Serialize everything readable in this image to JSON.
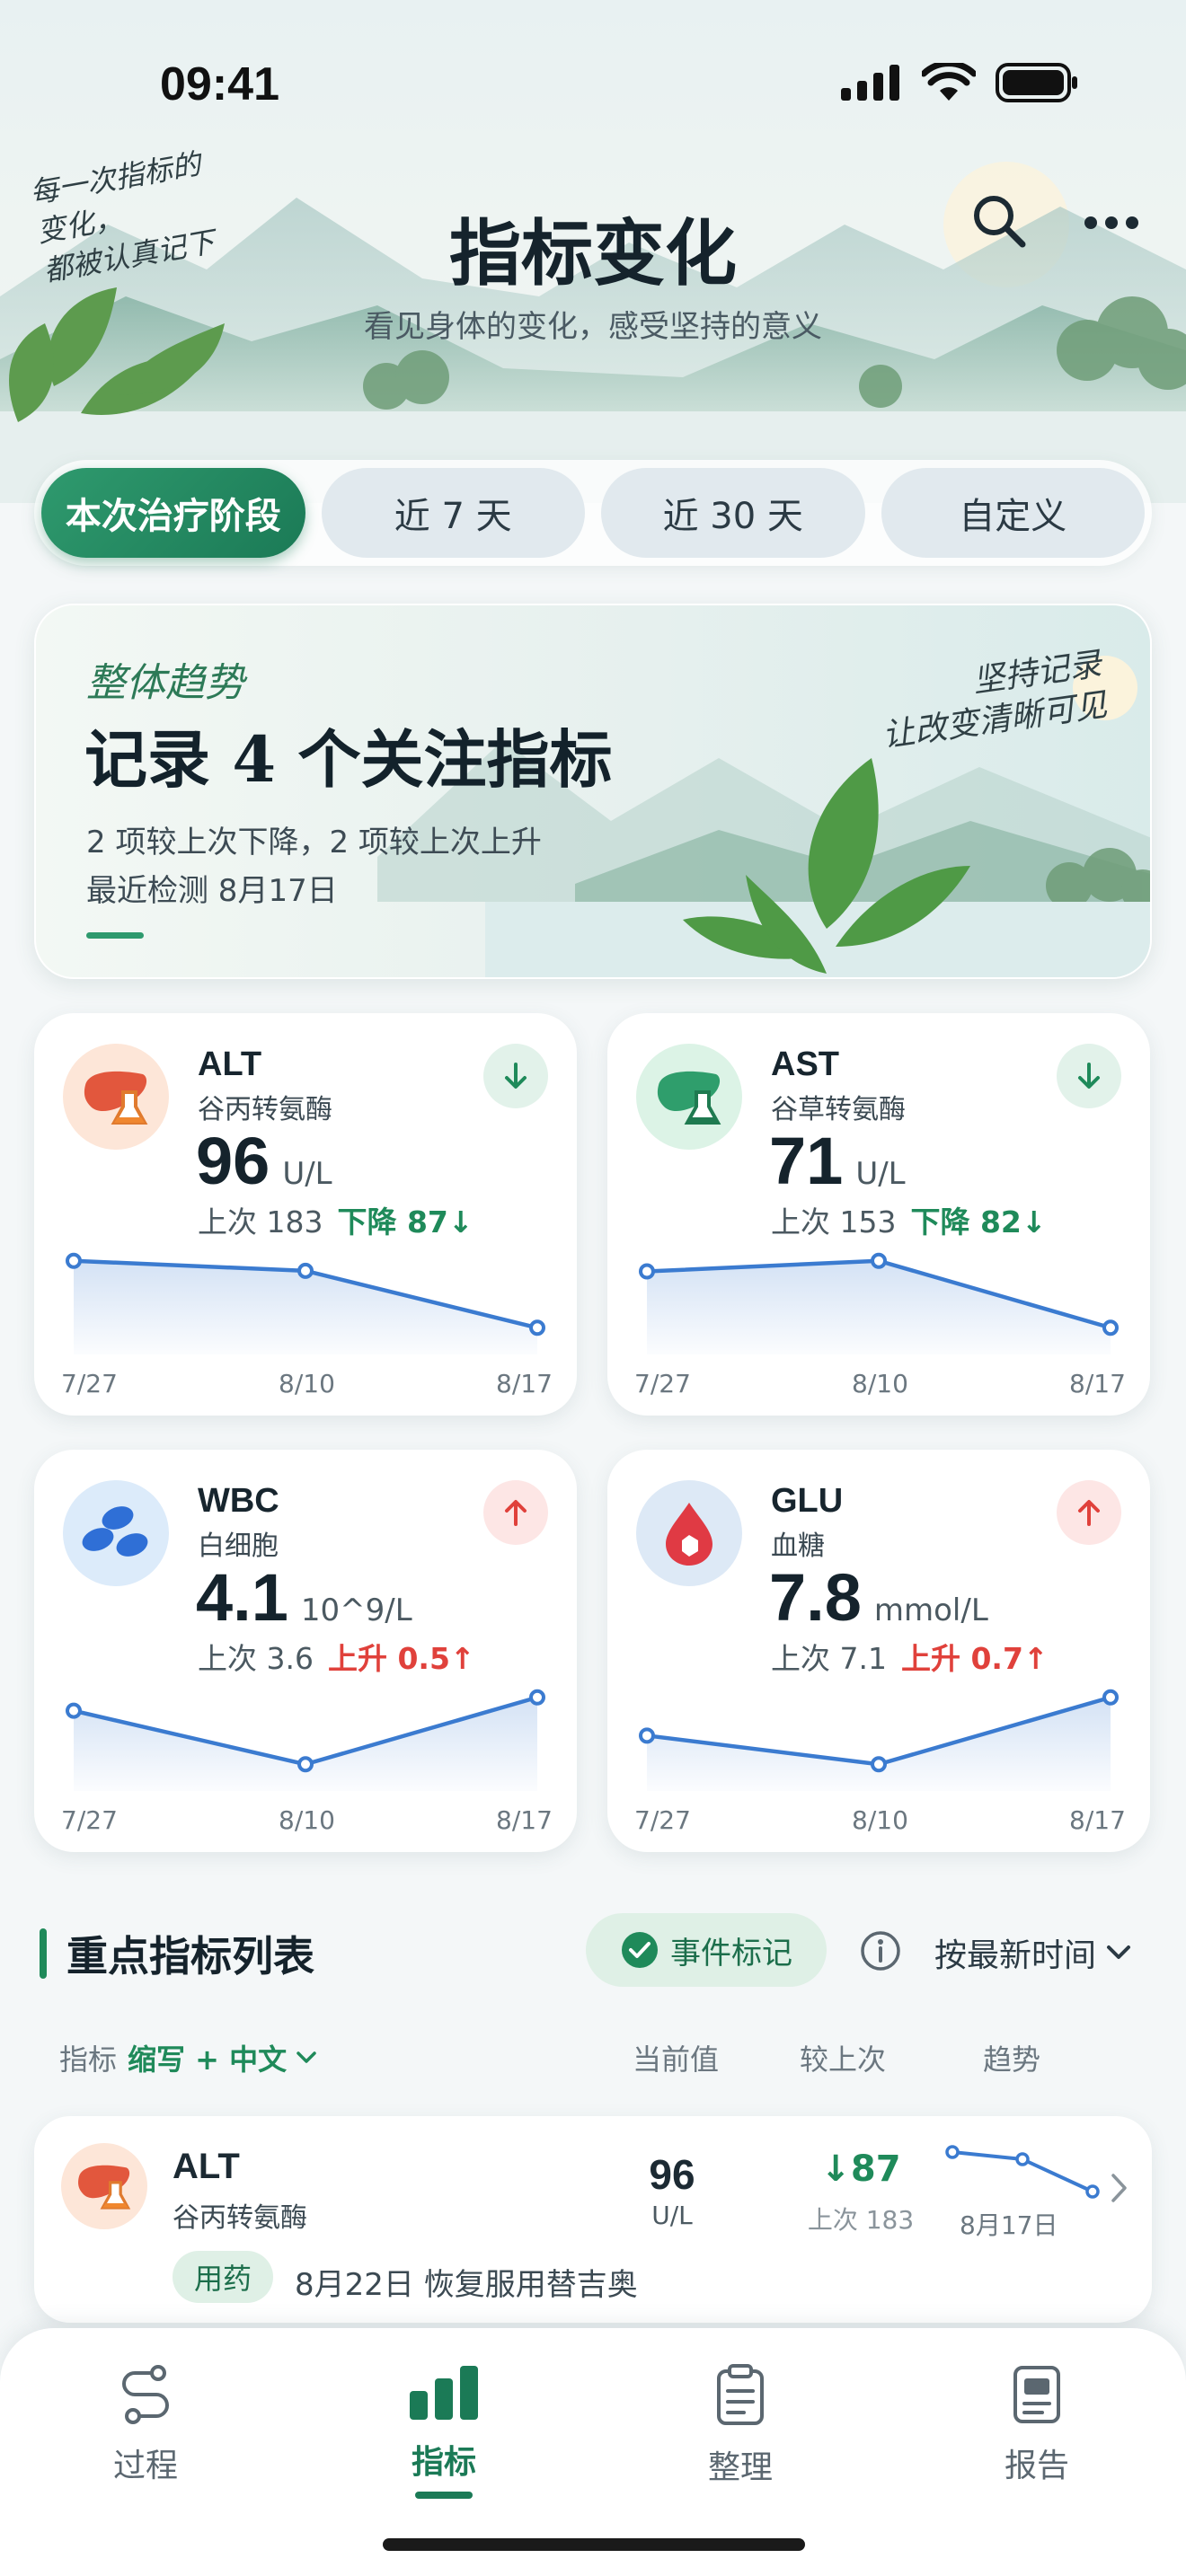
{
  "status_bar": {
    "time": "09:41"
  },
  "header": {
    "title": "指标变化",
    "subtitle": "看见身体的变化，感受坚持的意义",
    "handnote_lines": [
      "每一次指标的",
      "变化，",
      "都被认真记下"
    ]
  },
  "tabs": [
    {
      "label": "本次治疗阶段",
      "active": true
    },
    {
      "label": "近 7 天",
      "active": false
    },
    {
      "label": "近 30 天",
      "active": false
    },
    {
      "label": "自定义",
      "active": false
    }
  ],
  "banner": {
    "kicker": "整体趋势",
    "title": "记录 4 个关注指标",
    "line1": "2 项较上次下降，2 项较上次上升",
    "line2": "最近检测 8月17日",
    "note_lines": [
      "坚持记录",
      "让改变清晰可见"
    ]
  },
  "metrics": [
    {
      "code": "ALT",
      "name": "谷丙转氨酶",
      "value": "96",
      "unit": "U/L",
      "prev": "上次 183",
      "delta": "下降 87↓",
      "direction": "down",
      "icon": "liver-icon",
      "icon_bg": "#fde6d8",
      "x_labels": [
        "7/27",
        "8/10",
        "8/17"
      ],
      "trend": [
        183,
        170,
        96
      ]
    },
    {
      "code": "AST",
      "name": "谷草转氨酶",
      "value": "71",
      "unit": "U/L",
      "prev": "上次 153",
      "delta": "下降 82↓",
      "direction": "down",
      "icon": "liver-icon",
      "icon_bg": "#dcf3e6",
      "x_labels": [
        "7/27",
        "8/10",
        "8/17"
      ],
      "trend": [
        140,
        153,
        71
      ]
    },
    {
      "code": "WBC",
      "name": "白细胞",
      "value": "4.1",
      "unit": "10^9/L",
      "prev": "上次 3.6",
      "delta": "上升 0.5↑",
      "direction": "up",
      "icon": "blood-cells-icon",
      "icon_bg": "#dcebfa",
      "x_labels": [
        "7/27",
        "8/10",
        "8/17"
      ],
      "trend": [
        4.0,
        3.6,
        4.1
      ]
    },
    {
      "code": "GLU",
      "name": "血糖",
      "value": "7.8",
      "unit": "mmol/L",
      "prev": "上次 7.1",
      "delta": "上升 0.7↑",
      "direction": "up",
      "icon": "blood-drop-icon",
      "icon_bg": "#dde9f6",
      "x_labels": [
        "7/27",
        "8/10",
        "8/17"
      ],
      "trend": [
        7.4,
        7.1,
        7.8
      ]
    }
  ],
  "list_section": {
    "title": "重点指标列表",
    "event_chip": "事件标记",
    "sort_label": "按最新时间",
    "col_indicator": "指标",
    "col_indicator_mode": "缩写 + 中文",
    "col_current": "当前值",
    "col_compare": "较上次",
    "col_trend": "趋势",
    "rows": [
      {
        "code": "ALT",
        "name": "谷丙转氨酶",
        "value": "96",
        "unit": "U/L",
        "delta": "↓87",
        "prev": "上次 183",
        "date": "8月17日",
        "tag": "用药",
        "event": "8月22日 恢复服用替吉奥",
        "trend": [
          183,
          170,
          96
        ]
      }
    ]
  },
  "bottom_nav": [
    {
      "label": "过程",
      "icon": "route-icon",
      "active": false
    },
    {
      "label": "指标",
      "icon": "bar-chart-icon",
      "active": true
    },
    {
      "label": "整理",
      "icon": "clipboard-icon",
      "active": false
    },
    {
      "label": "报告",
      "icon": "report-icon",
      "active": false
    }
  ],
  "colors": {
    "accent": "#1b7a56",
    "down": "#1f8a5a",
    "up": "#e0413b",
    "line": "#3b7bd0"
  }
}
